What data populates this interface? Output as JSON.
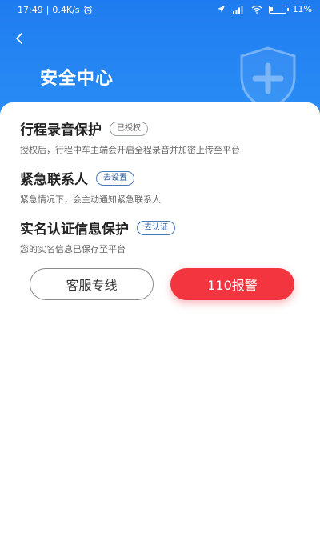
{
  "status_bar": {
    "time": "17:49",
    "network_speed": "0.4K/s",
    "battery": "11%"
  },
  "header": {
    "title": "安全中心"
  },
  "items": [
    {
      "title": "行程录音保护",
      "tag": "已授权",
      "desc": "授权后，行程中车主端会开启全程录音并加密上传至平台"
    },
    {
      "title": "紧急联系人",
      "tag": "去设置",
      "desc": "紧急情况下，会主动通知紧急联系人"
    },
    {
      "title": "实名认证信息保护",
      "tag": "去认证",
      "desc": "您的实名信息已保存至平台"
    }
  ],
  "buttons": {
    "service": "客服专线",
    "police": "110报警"
  },
  "colors": {
    "header_blue": "#1f7cf0",
    "alarm_red": "#f2353f"
  }
}
